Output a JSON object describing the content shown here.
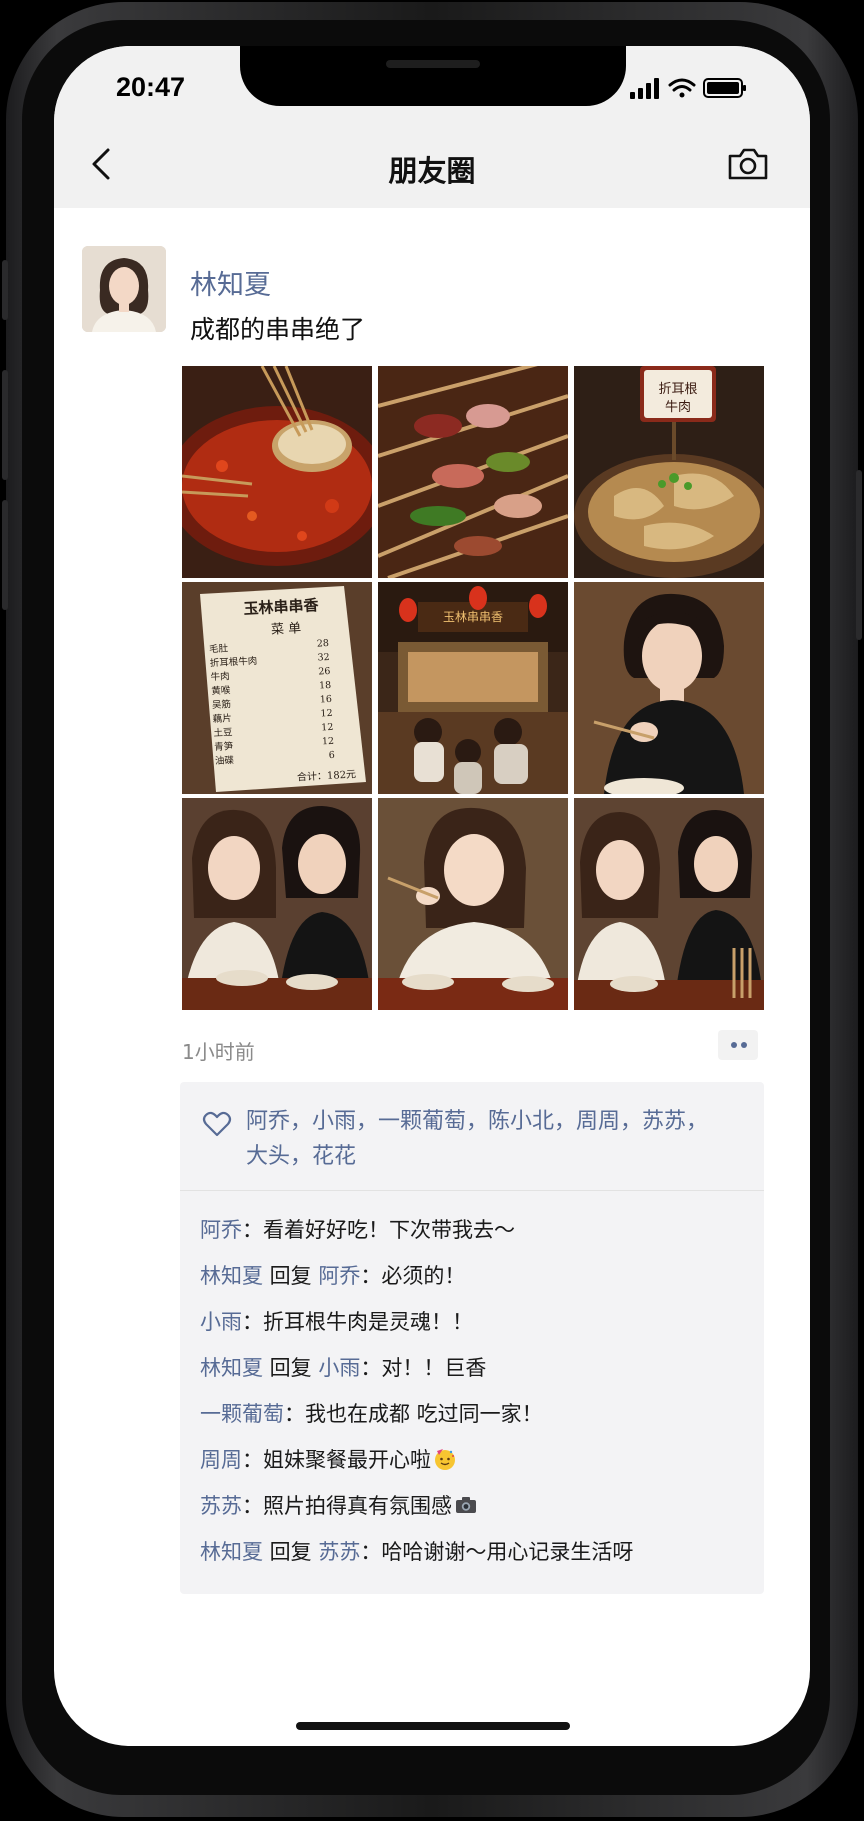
{
  "status_bar": {
    "time": "20:47"
  },
  "nav": {
    "title": "朋友圈",
    "back_icon": "chevron-left-icon",
    "camera_icon": "camera-icon"
  },
  "post": {
    "author": "林知夏",
    "text": "成都的串串绝了",
    "time_ago": "1小时前",
    "photos": [
      {
        "label": "skewers-in-hot-pot"
      },
      {
        "label": "meat-skewers-closeup"
      },
      {
        "label": "beef-dish",
        "sign": [
          "折耳根",
          "牛肉"
        ]
      },
      {
        "label": "menu-card",
        "menu": {
          "title": "玉林串串香",
          "heading": "菜 单",
          "items": [
            {
              "name": "毛肚",
              "price": "28"
            },
            {
              "name": "折耳根牛肉",
              "price": "32"
            },
            {
              "name": "牛肉",
              "price": "26"
            },
            {
              "name": "黄喉",
              "price": "18"
            },
            {
              "name": "吴筋",
              "price": "16"
            },
            {
              "name": "藕片",
              "price": "12"
            },
            {
              "name": "土豆",
              "price": "12"
            },
            {
              "name": "青笋",
              "price": "12"
            },
            {
              "name": "油碟",
              "price": "6"
            }
          ],
          "total": "合计：182元"
        }
      },
      {
        "label": "restaurant-interior",
        "sign": "玉林串串香"
      },
      {
        "label": "woman-eating"
      },
      {
        "label": "two-friends-eating"
      },
      {
        "label": "woman-smiling-eating"
      },
      {
        "label": "friends-at-table"
      }
    ],
    "likes": {
      "icon": "heart-icon",
      "line1": "阿乔，小雨，一颗葡萄，陈小北，周周，苏苏，",
      "line2": "大头，花花"
    },
    "comments": [
      {
        "from": "阿乔",
        "to": "",
        "sep": "：",
        "text": "看着好好吃！下次带我去～"
      },
      {
        "from": "林知夏",
        "reply": " 回复 ",
        "to": "阿乔",
        "sep": "：",
        "text": "必须的！"
      },
      {
        "from": "小雨",
        "to": "",
        "sep": "：",
        "text": "折耳根牛肉是灵魂！！"
      },
      {
        "from": "林知夏",
        "reply": " 回复 ",
        "to": "小雨",
        "sep": "：",
        "text": "对！！巨香"
      },
      {
        "from": "一颗葡萄",
        "to": "",
        "sep": "：",
        "text": "我也在成都 吃过同一家！"
      },
      {
        "from": "周周",
        "to": "",
        "sep": "：",
        "text": "姐妹聚餐最开心啦",
        "emoji": "party-face-icon"
      },
      {
        "from": "苏苏",
        "to": "",
        "sep": "：",
        "text": "照片拍得真有氛围感",
        "emoji": "camera-emoji-icon"
      },
      {
        "from": "林知夏",
        "reply": " 回复 ",
        "to": "苏苏",
        "sep": "：",
        "text": "哈哈谢谢～用心记录生活呀"
      }
    ]
  },
  "colors": {
    "link": "#576b95",
    "topbar": "#f1f1f1",
    "interaction_bg": "#f3f3f5"
  }
}
